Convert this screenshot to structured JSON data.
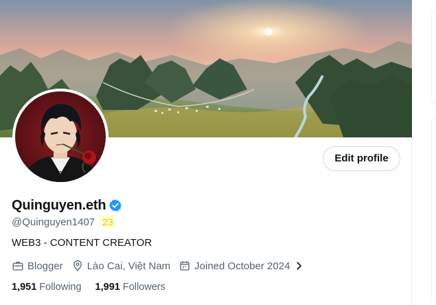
{
  "profile": {
    "display_name": "Quinguyen.eth",
    "handle": "@Quinguyen1407",
    "handle_badge": "23",
    "bio": "WEB3 - CONTENT CREATOR",
    "edit_profile_label": "Edit profile"
  },
  "meta": {
    "category_label": "Blogger",
    "location_label": "Lào Cai, Việt Nam",
    "joined_label": "Joined October 2024"
  },
  "stats": {
    "following_count": "1,951",
    "following_label": "Following",
    "followers_count": "1,991",
    "followers_label": "Followers"
  },
  "icons": {
    "verified": "verified-badge-icon",
    "category": "briefcase-icon",
    "location": "location-pin-icon",
    "joined": "calendar-icon",
    "expand": "chevron-right-icon"
  },
  "colors": {
    "verified_blue": "#1d9bf0",
    "text_primary": "#0f1419",
    "text_secondary": "#536471",
    "button_border": "#cfd9de"
  }
}
